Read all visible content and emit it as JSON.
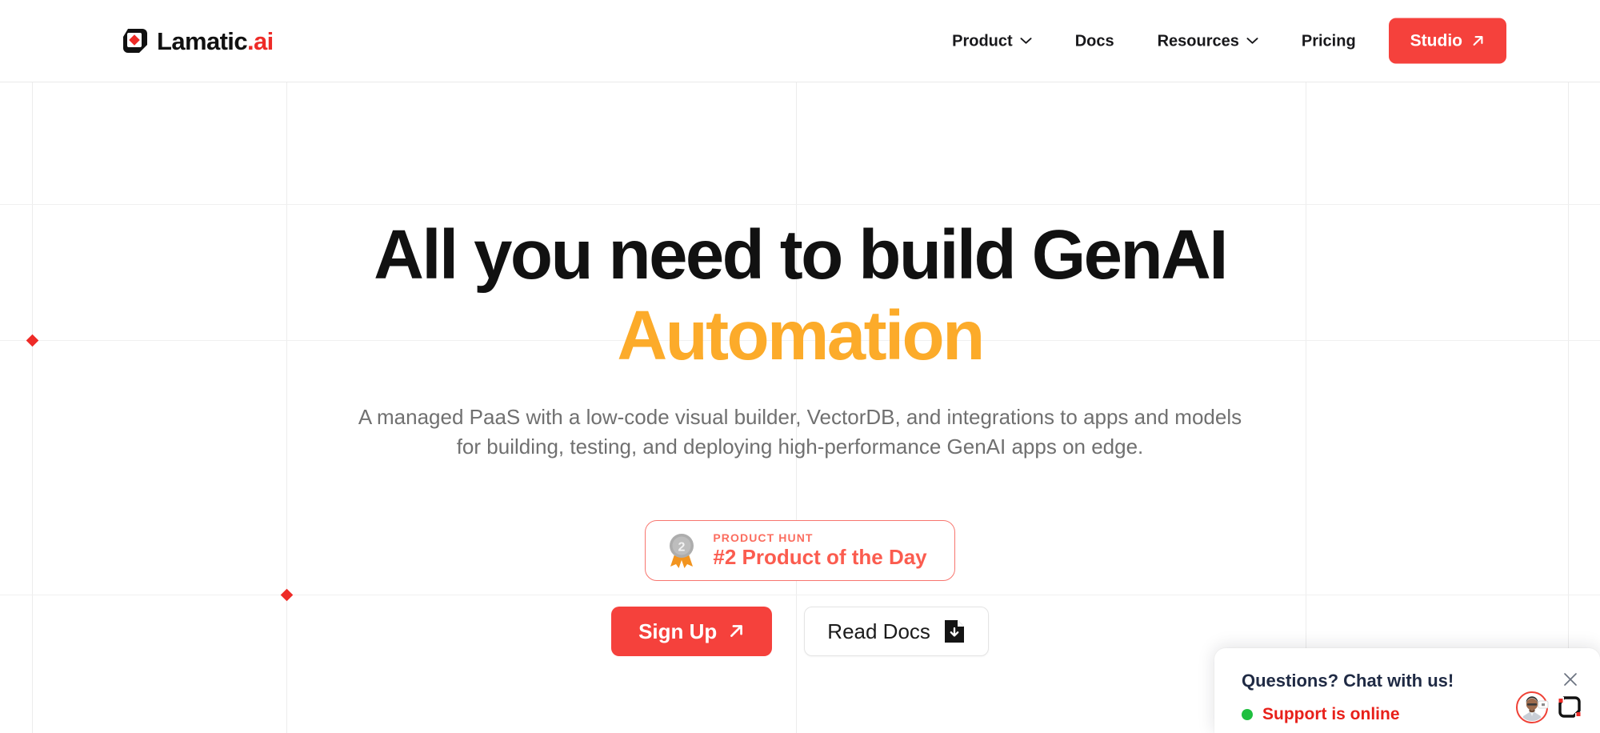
{
  "brand": {
    "name": "Lamatic",
    "suffix": ".ai",
    "logo_icon": "lamatic-diamond-logo-icon",
    "accent_red": "#ee2b27",
    "accent_orange": "#fcab2a"
  },
  "header": {
    "nav": [
      {
        "label": "Product",
        "icon": "chevron-down-icon",
        "has_dropdown": true
      },
      {
        "label": "Docs",
        "icon": "",
        "has_dropdown": false
      },
      {
        "label": "Resources",
        "icon": "chevron-down-icon",
        "has_dropdown": true
      },
      {
        "label": "Pricing",
        "icon": "",
        "has_dropdown": false
      }
    ],
    "cta": {
      "label": "Studio",
      "icon": "arrow-up-right-icon",
      "color": "#f5413c"
    }
  },
  "hero": {
    "headline_line1": "All you need to build GenAI",
    "headline_line2": "Automation",
    "subtitle": "A managed PaaS with a low-code visual builder, VectorDB, and integrations to apps and models for building, testing, and deploying high-performance GenAI apps on edge.",
    "product_hunt": {
      "kicker": "PRODUCT HUNT",
      "title": "#2 Product of the Day",
      "rank": "2",
      "icon": "product-hunt-medal-icon",
      "border_color": "#f8766f",
      "text_color": "#fb5c4f"
    },
    "buttons": [
      {
        "label": "Sign Up",
        "icon": "arrow-up-right-icon",
        "style": "primary"
      },
      {
        "label": "Read Docs",
        "icon": "document-download-icon",
        "style": "secondary"
      }
    ]
  },
  "chat_widget": {
    "title": "Questions? Chat with us!",
    "status_text": "Support is online",
    "status_color": "#e8201a",
    "status_dot_color": "#1fbf3f",
    "close_icon": "close-icon",
    "avatar_icon": "support-agent-avatar",
    "brand_icon": "lamatic-bracket-logo-icon"
  }
}
